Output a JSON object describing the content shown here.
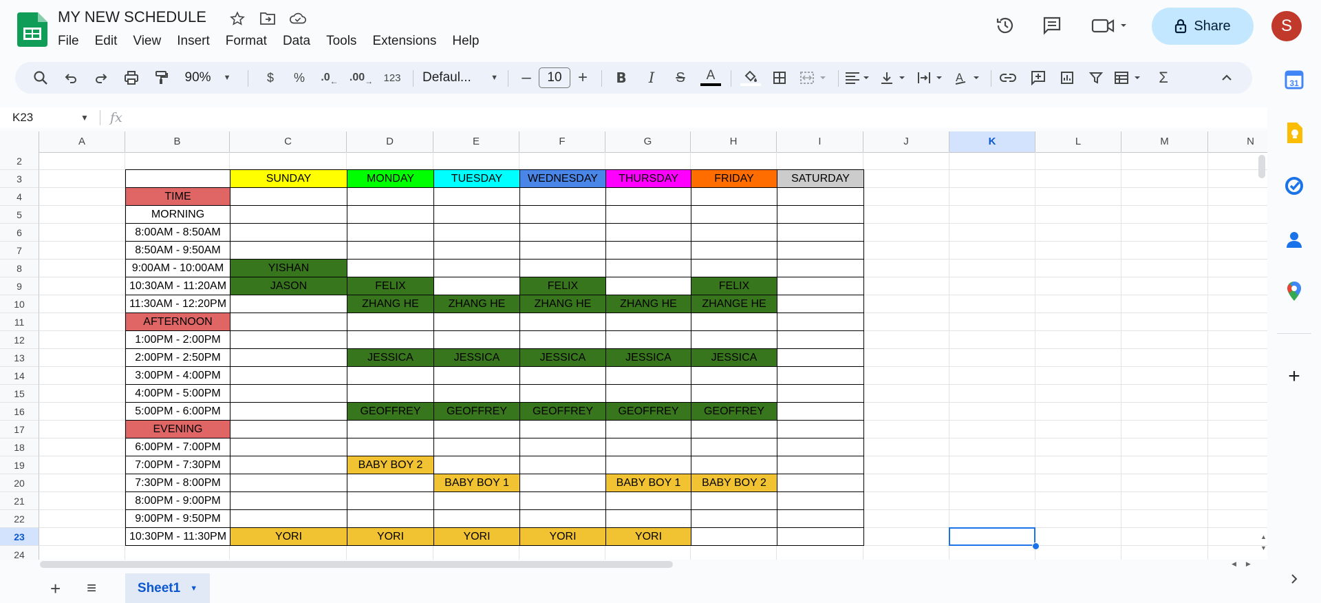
{
  "app": {
    "doc_title": "MY NEW SCHEDULE",
    "menu": [
      "File",
      "Edit",
      "View",
      "Insert",
      "Format",
      "Data",
      "Tools",
      "Extensions",
      "Help"
    ],
    "share_label": "Share",
    "avatar_letter": "S"
  },
  "toolbar": {
    "zoom": "90%",
    "currency": "$",
    "percent": "%",
    "dec_decrease": ".0",
    "dec_increase": ".00",
    "number_format": "123",
    "font": "Defaul...",
    "font_size": "10"
  },
  "formula_bar": {
    "name_box": "K23",
    "fx": "fx",
    "value": ""
  },
  "grid": {
    "columns": [
      "A",
      "B",
      "C",
      "D",
      "E",
      "F",
      "G",
      "H",
      "I",
      "J",
      "K",
      "L",
      "M",
      "N"
    ],
    "rows": [
      "2",
      "3",
      "4",
      "5",
      "6",
      "7",
      "8",
      "9",
      "10",
      "11",
      "12",
      "13",
      "14",
      "15",
      "16",
      "17",
      "18",
      "19",
      "20",
      "21",
      "22",
      "23",
      "24"
    ],
    "selected_col": "K",
    "selected_row": "23"
  },
  "schedule": {
    "days": [
      {
        "label": "SUNDAY",
        "color": "#ffff00"
      },
      {
        "label": "MONDAY",
        "color": "#00ff00"
      },
      {
        "label": "TUESDAY",
        "color": "#00ffff"
      },
      {
        "label": "WEDNESDAY",
        "color": "#4a86e8"
      },
      {
        "label": "THURSDAY",
        "color": "#ff00ff"
      },
      {
        "label": "FRIDAY",
        "color": "#ff6d01"
      },
      {
        "label": "SATURDAY",
        "color": "#cccccc"
      }
    ],
    "times": [
      {
        "label": "TIME",
        "header": true
      },
      {
        "label": "MORNING",
        "header": false
      },
      {
        "label": "8:00AM - 8:50AM",
        "header": false
      },
      {
        "label": "8:50AM - 9:50AM",
        "header": false
      },
      {
        "label": "9:00AM - 10:00AM",
        "header": false
      },
      {
        "label": "10:30AM - 11:20AM",
        "header": false
      },
      {
        "label": "11:30AM - 12:20PM",
        "header": false
      },
      {
        "label": "AFTERNOON",
        "header": true
      },
      {
        "label": "1:00PM - 2:00PM",
        "header": false
      },
      {
        "label": "2:00PM - 2:50PM",
        "header": false
      },
      {
        "label": "3:00PM - 4:00PM",
        "header": false
      },
      {
        "label": "4:00PM - 5:00PM",
        "header": false
      },
      {
        "label": "5:00PM - 6:00PM",
        "header": false
      },
      {
        "label": "EVENING",
        "header": true
      },
      {
        "label": "6:00PM - 7:00PM",
        "header": false
      },
      {
        "label": "7:00PM - 7:30PM",
        "header": false
      },
      {
        "label": "7:30PM - 8:00PM",
        "header": false
      },
      {
        "label": "8:00PM - 9:00PM",
        "header": false
      },
      {
        "label": "9:00PM - 9:50PM",
        "header": false
      },
      {
        "label": "10:30PM - 11:30PM",
        "header": false
      }
    ],
    "entries": [
      {
        "row": 4,
        "col": 0,
        "text": "YISHAN",
        "color": "#38761d"
      },
      {
        "row": 5,
        "col": 0,
        "text": "JASON",
        "color": "#38761d"
      },
      {
        "row": 5,
        "col": 1,
        "text": "FELIX",
        "color": "#38761d"
      },
      {
        "row": 5,
        "col": 3,
        "text": "FELIX",
        "color": "#38761d"
      },
      {
        "row": 5,
        "col": 5,
        "text": "FELIX",
        "color": "#38761d"
      },
      {
        "row": 6,
        "col": 1,
        "text": "ZHANG HE",
        "color": "#38761d"
      },
      {
        "row": 6,
        "col": 2,
        "text": "ZHANG HE",
        "color": "#38761d"
      },
      {
        "row": 6,
        "col": 3,
        "text": "ZHANG HE",
        "color": "#38761d"
      },
      {
        "row": 6,
        "col": 4,
        "text": "ZHANG HE",
        "color": "#38761d"
      },
      {
        "row": 6,
        "col": 5,
        "text": "ZHANGE HE",
        "color": "#38761d"
      },
      {
        "row": 9,
        "col": 1,
        "text": "JESSICA",
        "color": "#38761d"
      },
      {
        "row": 9,
        "col": 2,
        "text": "JESSICA",
        "color": "#38761d"
      },
      {
        "row": 9,
        "col": 3,
        "text": "JESSICA",
        "color": "#38761d"
      },
      {
        "row": 9,
        "col": 4,
        "text": "JESSICA",
        "color": "#38761d"
      },
      {
        "row": 9,
        "col": 5,
        "text": "JESSICA",
        "color": "#38761d"
      },
      {
        "row": 12,
        "col": 1,
        "text": "GEOFFREY",
        "color": "#38761d"
      },
      {
        "row": 12,
        "col": 2,
        "text": "GEOFFREY",
        "color": "#38761d"
      },
      {
        "row": 12,
        "col": 3,
        "text": "GEOFFREY",
        "color": "#38761d"
      },
      {
        "row": 12,
        "col": 4,
        "text": "GEOFFREY",
        "color": "#38761d"
      },
      {
        "row": 12,
        "col": 5,
        "text": "GEOFFREY",
        "color": "#38761d"
      },
      {
        "row": 15,
        "col": 1,
        "text": "BABY BOY 2",
        "color": "#f1c232"
      },
      {
        "row": 16,
        "col": 2,
        "text": "BABY BOY 1",
        "color": "#f1c232"
      },
      {
        "row": 16,
        "col": 4,
        "text": "BABY BOY 1",
        "color": "#f1c232"
      },
      {
        "row": 16,
        "col": 5,
        "text": "BABY BOY 2",
        "color": "#f1c232"
      },
      {
        "row": 19,
        "col": 0,
        "text": "YORI",
        "color": "#f1c232"
      },
      {
        "row": 19,
        "col": 1,
        "text": "YORI",
        "color": "#f1c232"
      },
      {
        "row": 19,
        "col": 2,
        "text": "YORI",
        "color": "#f1c232"
      },
      {
        "row": 19,
        "col": 3,
        "text": "YORI",
        "color": "#f1c232"
      },
      {
        "row": 19,
        "col": 4,
        "text": "YORI",
        "color": "#f1c232"
      }
    ],
    "header_color": "#e06666"
  },
  "sheets": {
    "active": "Sheet1"
  },
  "side_panel": {
    "icons": [
      "calendar-icon",
      "keep-icon",
      "tasks-icon",
      "contacts-icon",
      "maps-icon",
      "add-icon"
    ]
  }
}
